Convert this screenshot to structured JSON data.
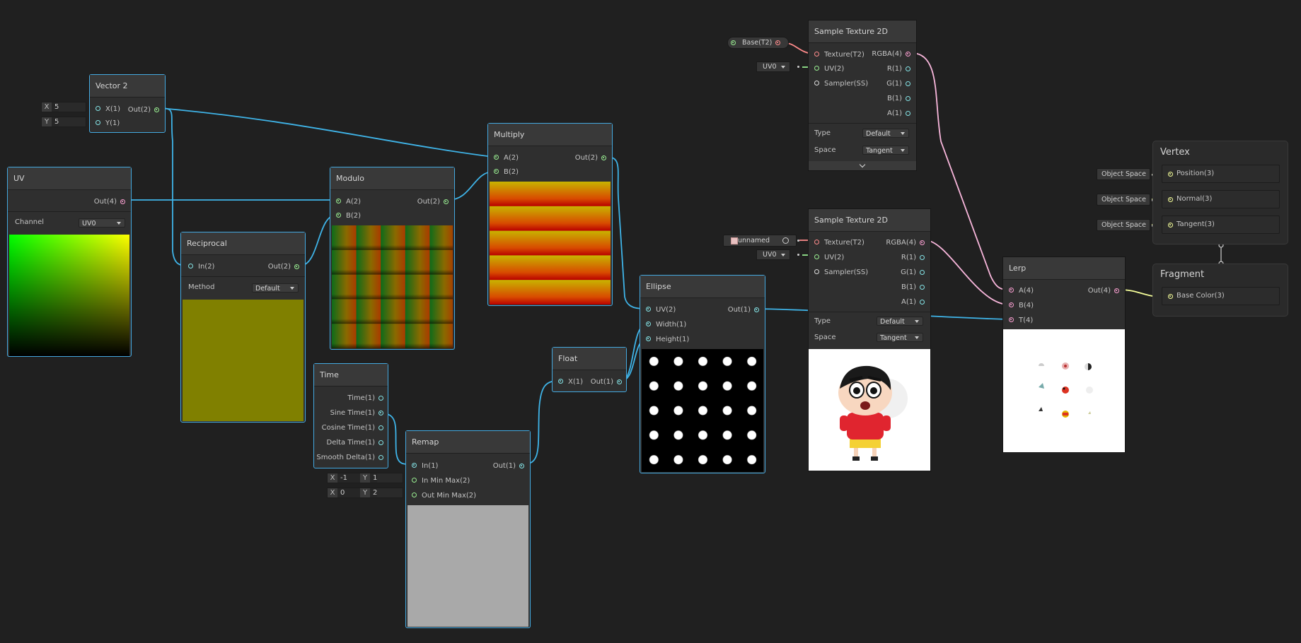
{
  "nodes": {
    "vector2": {
      "title": "Vector 2",
      "in_x": "X(1)",
      "in_y": "Y(1)",
      "out": "Out(2)",
      "x_label": "X",
      "x_value": "5",
      "y_label": "Y",
      "y_value": "5"
    },
    "uv": {
      "title": "UV",
      "out": "Out(4)",
      "channel_label": "Channel",
      "channel_value": "UV0"
    },
    "reciprocal": {
      "title": "Reciprocal",
      "in": "In(2)",
      "out": "Out(2)",
      "method_label": "Method",
      "method_value": "Default"
    },
    "modulo": {
      "title": "Modulo",
      "in_a": "A(2)",
      "in_b": "B(2)",
      "out": "Out(2)"
    },
    "multiply": {
      "title": "Multiply",
      "in_a": "A(2)",
      "in_b": "B(2)",
      "out": "Out(2)"
    },
    "time": {
      "title": "Time",
      "outputs": [
        "Time(1)",
        "Sine Time(1)",
        "Cosine Time(1)",
        "Delta Time(1)",
        "Smooth Delta(1)"
      ]
    },
    "remap": {
      "title": "Remap",
      "in": "In(1)",
      "in_minmax": "In Min Max(2)",
      "out_minmax": "Out Min Max(2)",
      "out": "Out(1)",
      "in_x_label": "X",
      "in_x": "-1",
      "in_y_label": "Y",
      "in_y": "1",
      "out_x_label": "X",
      "out_x": "0",
      "out_y_label": "Y",
      "out_y": "2"
    },
    "float": {
      "title": "Float",
      "in": "X(1)",
      "out": "Out(1)"
    },
    "ellipse": {
      "title": "Ellipse",
      "in_uv": "UV(2)",
      "in_w": "Width(1)",
      "in_h": "Height(1)",
      "out": "Out(1)"
    },
    "sample1": {
      "title": "Sample Texture 2D",
      "in_tex": "Texture(T2)",
      "in_uv": "UV(2)",
      "in_ss": "Sampler(SS)",
      "outs": [
        "RGBA(4)",
        "R(1)",
        "G(1)",
        "B(1)",
        "A(1)"
      ],
      "type_label": "Type",
      "type_value": "Default",
      "space_label": "Space",
      "space_value": "Tangent",
      "prop": "Base(T2)",
      "uv_value": "UV0"
    },
    "sample2": {
      "title": "Sample Texture 2D",
      "in_tex": "Texture(T2)",
      "in_uv": "UV(2)",
      "in_ss": "Sampler(SS)",
      "outs": [
        "RGBA(4)",
        "R(1)",
        "G(1)",
        "B(1)",
        "A(1)"
      ],
      "type_label": "Type",
      "type_value": "Default",
      "space_label": "Space",
      "space_value": "Tangent",
      "tex_value": "unnamed",
      "uv_value": "UV0"
    },
    "lerp": {
      "title": "Lerp",
      "in_a": "A(4)",
      "in_b": "B(4)",
      "in_t": "T(4)",
      "out": "Out(4)"
    }
  },
  "vertex": {
    "title": "Vertex",
    "slots": [
      "Position(3)",
      "Normal(3)",
      "Tangent(3)"
    ],
    "space": "Object Space"
  },
  "fragment": {
    "title": "Fragment",
    "slot": "Base Color(3)"
  },
  "colors": {
    "selection": "#44a9e0",
    "wire_vec": "#3fb4e8",
    "wire_tex": "#ff8b8b",
    "wire_col": "#f9b7dc",
    "wire_vec3": "#f6ff9a"
  }
}
